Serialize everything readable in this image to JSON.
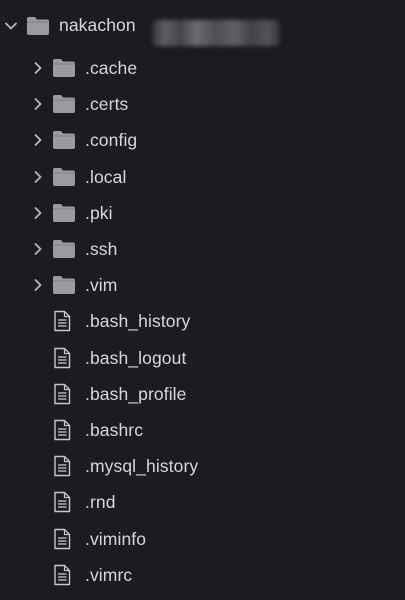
{
  "root": {
    "name": "nakachon",
    "expanded": true,
    "obscured_suffix_icon": "blurred-text"
  },
  "folders": [
    {
      "name": ".cache",
      "icon": "folder-icon",
      "expanded": false
    },
    {
      "name": ".certs",
      "icon": "folder-icon",
      "expanded": false
    },
    {
      "name": ".config",
      "icon": "folder-icon",
      "expanded": false
    },
    {
      "name": ".local",
      "icon": "folder-icon",
      "expanded": false
    },
    {
      "name": ".pki",
      "icon": "folder-icon",
      "expanded": false
    },
    {
      "name": ".ssh",
      "icon": "folder-icon",
      "expanded": false
    },
    {
      "name": ".vim",
      "icon": "folder-icon",
      "expanded": false
    }
  ],
  "files": [
    {
      "name": ".bash_history",
      "icon": "file-icon"
    },
    {
      "name": ".bash_logout",
      "icon": "file-icon"
    },
    {
      "name": ".bash_profile",
      "icon": "file-icon"
    },
    {
      "name": ".bashrc",
      "icon": "file-icon"
    },
    {
      "name": ".mysql_history",
      "icon": "file-icon"
    },
    {
      "name": ".rnd",
      "icon": "file-icon"
    },
    {
      "name": ".viminfo",
      "icon": "file-icon"
    },
    {
      "name": ".vimrc",
      "icon": "file-icon"
    }
  ],
  "colors": {
    "background": "#1c1c20",
    "text": "#d8d8dc",
    "icon": "#9a9aa0",
    "chevron": "#b8b8bc"
  }
}
